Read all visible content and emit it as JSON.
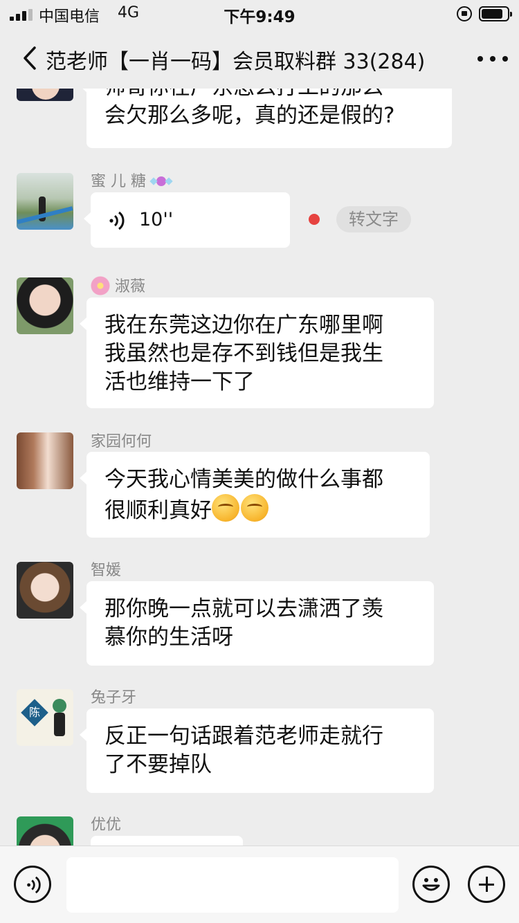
{
  "status_bar": {
    "carrier": "中国电信",
    "network": "4G",
    "time": "下午9:49"
  },
  "header": {
    "title": "范老师【一肖一码】会员取料群 33(284)"
  },
  "messages": [
    {
      "sender": "",
      "text_lines": [
        "师哥你在广东怎么打工的那么",
        "会欠那么多呢，真的还是假的?"
      ]
    },
    {
      "sender": "蜜 儿 糖",
      "type": "voice",
      "duration": "10''",
      "to_text_label": "转文字"
    },
    {
      "sender": "淑薇",
      "text_lines": [
        "我在东莞这边你在广东哪里啊",
        "我虽然也是存不到钱但是我生",
        "活也维持一下了"
      ]
    },
    {
      "sender": "家园何何",
      "text_lines": [
        "今天我心情美美的做什么事都",
        "很顺利真好"
      ]
    },
    {
      "sender": "智媛",
      "text_lines": [
        "那你晚一点就可以去潇洒了羡",
        "慕你的生活呀"
      ]
    },
    {
      "sender": "兔子牙",
      "text_lines": [
        "反正一句话跟着范老师走就行",
        "了不要掉队"
      ]
    },
    {
      "sender": "优优",
      "text_lines": []
    }
  ],
  "avatar_badge": "陈",
  "icons": [
    "back-chevron-icon",
    "more-dots-icon",
    "voice-wave-icon",
    "emoji-face-icon",
    "plus-icon",
    "flower-icon",
    "candy-icon"
  ],
  "colors": {
    "background": "#ededed",
    "bubble": "#ffffff",
    "unread": "#e64340",
    "sender": "#888888"
  }
}
